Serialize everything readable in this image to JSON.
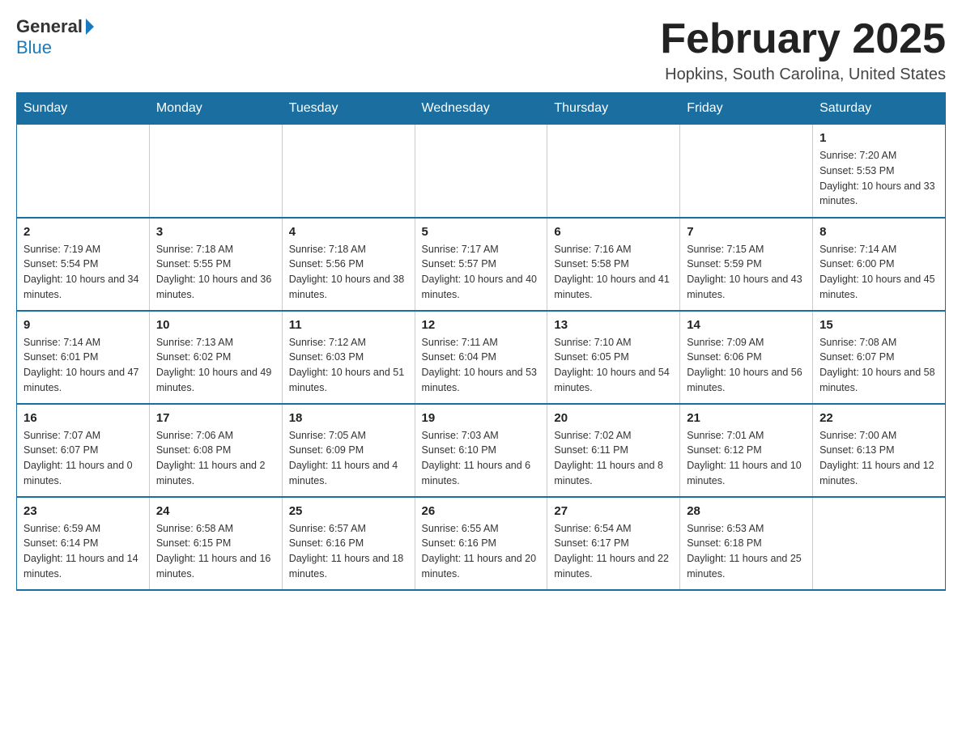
{
  "header": {
    "logo": {
      "general": "General",
      "blue": "Blue"
    },
    "title": "February 2025",
    "location": "Hopkins, South Carolina, United States"
  },
  "weekdays": [
    "Sunday",
    "Monday",
    "Tuesday",
    "Wednesday",
    "Thursday",
    "Friday",
    "Saturday"
  ],
  "weeks": [
    [
      {
        "day": "",
        "info": ""
      },
      {
        "day": "",
        "info": ""
      },
      {
        "day": "",
        "info": ""
      },
      {
        "day": "",
        "info": ""
      },
      {
        "day": "",
        "info": ""
      },
      {
        "day": "",
        "info": ""
      },
      {
        "day": "1",
        "info": "Sunrise: 7:20 AM\nSunset: 5:53 PM\nDaylight: 10 hours and 33 minutes."
      }
    ],
    [
      {
        "day": "2",
        "info": "Sunrise: 7:19 AM\nSunset: 5:54 PM\nDaylight: 10 hours and 34 minutes."
      },
      {
        "day": "3",
        "info": "Sunrise: 7:18 AM\nSunset: 5:55 PM\nDaylight: 10 hours and 36 minutes."
      },
      {
        "day": "4",
        "info": "Sunrise: 7:18 AM\nSunset: 5:56 PM\nDaylight: 10 hours and 38 minutes."
      },
      {
        "day": "5",
        "info": "Sunrise: 7:17 AM\nSunset: 5:57 PM\nDaylight: 10 hours and 40 minutes."
      },
      {
        "day": "6",
        "info": "Sunrise: 7:16 AM\nSunset: 5:58 PM\nDaylight: 10 hours and 41 minutes."
      },
      {
        "day": "7",
        "info": "Sunrise: 7:15 AM\nSunset: 5:59 PM\nDaylight: 10 hours and 43 minutes."
      },
      {
        "day": "8",
        "info": "Sunrise: 7:14 AM\nSunset: 6:00 PM\nDaylight: 10 hours and 45 minutes."
      }
    ],
    [
      {
        "day": "9",
        "info": "Sunrise: 7:14 AM\nSunset: 6:01 PM\nDaylight: 10 hours and 47 minutes."
      },
      {
        "day": "10",
        "info": "Sunrise: 7:13 AM\nSunset: 6:02 PM\nDaylight: 10 hours and 49 minutes."
      },
      {
        "day": "11",
        "info": "Sunrise: 7:12 AM\nSunset: 6:03 PM\nDaylight: 10 hours and 51 minutes."
      },
      {
        "day": "12",
        "info": "Sunrise: 7:11 AM\nSunset: 6:04 PM\nDaylight: 10 hours and 53 minutes."
      },
      {
        "day": "13",
        "info": "Sunrise: 7:10 AM\nSunset: 6:05 PM\nDaylight: 10 hours and 54 minutes."
      },
      {
        "day": "14",
        "info": "Sunrise: 7:09 AM\nSunset: 6:06 PM\nDaylight: 10 hours and 56 minutes."
      },
      {
        "day": "15",
        "info": "Sunrise: 7:08 AM\nSunset: 6:07 PM\nDaylight: 10 hours and 58 minutes."
      }
    ],
    [
      {
        "day": "16",
        "info": "Sunrise: 7:07 AM\nSunset: 6:07 PM\nDaylight: 11 hours and 0 minutes."
      },
      {
        "day": "17",
        "info": "Sunrise: 7:06 AM\nSunset: 6:08 PM\nDaylight: 11 hours and 2 minutes."
      },
      {
        "day": "18",
        "info": "Sunrise: 7:05 AM\nSunset: 6:09 PM\nDaylight: 11 hours and 4 minutes."
      },
      {
        "day": "19",
        "info": "Sunrise: 7:03 AM\nSunset: 6:10 PM\nDaylight: 11 hours and 6 minutes."
      },
      {
        "day": "20",
        "info": "Sunrise: 7:02 AM\nSunset: 6:11 PM\nDaylight: 11 hours and 8 minutes."
      },
      {
        "day": "21",
        "info": "Sunrise: 7:01 AM\nSunset: 6:12 PM\nDaylight: 11 hours and 10 minutes."
      },
      {
        "day": "22",
        "info": "Sunrise: 7:00 AM\nSunset: 6:13 PM\nDaylight: 11 hours and 12 minutes."
      }
    ],
    [
      {
        "day": "23",
        "info": "Sunrise: 6:59 AM\nSunset: 6:14 PM\nDaylight: 11 hours and 14 minutes."
      },
      {
        "day": "24",
        "info": "Sunrise: 6:58 AM\nSunset: 6:15 PM\nDaylight: 11 hours and 16 minutes."
      },
      {
        "day": "25",
        "info": "Sunrise: 6:57 AM\nSunset: 6:16 PM\nDaylight: 11 hours and 18 minutes."
      },
      {
        "day": "26",
        "info": "Sunrise: 6:55 AM\nSunset: 6:16 PM\nDaylight: 11 hours and 20 minutes."
      },
      {
        "day": "27",
        "info": "Sunrise: 6:54 AM\nSunset: 6:17 PM\nDaylight: 11 hours and 22 minutes."
      },
      {
        "day": "28",
        "info": "Sunrise: 6:53 AM\nSunset: 6:18 PM\nDaylight: 11 hours and 25 minutes."
      },
      {
        "day": "",
        "info": ""
      }
    ]
  ]
}
